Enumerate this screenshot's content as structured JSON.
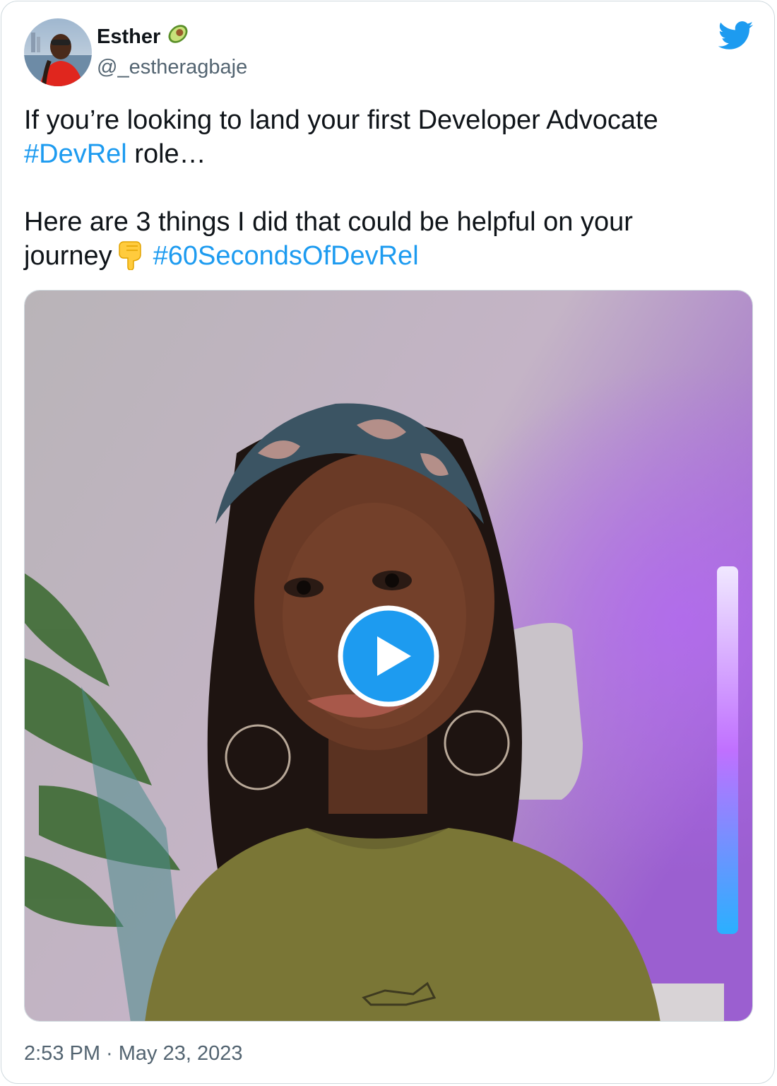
{
  "author": {
    "display_name": "Esther",
    "name_emoji_icon": "avocado-icon",
    "handle": "@_estheragbaje",
    "avatar_icon": "avatar-photo"
  },
  "tweet": {
    "line1": "If you’re looking to land your first Developer Advocate",
    "hashtag1": "#DevRel",
    "line2_rest": " role…",
    "line3": "Here are 3 things I did that could be helpful on your",
    "line4_start": "journey",
    "emoji_icon": "pointing-down-emoji",
    "hashtag2": "#60SecondsOfDevRel"
  },
  "media": {
    "type": "video",
    "play_icon": "play-icon"
  },
  "meta": {
    "timestamp": "2:53 PM · May 23, 2023"
  },
  "colors": {
    "link": "#1d9bf0",
    "text": "#0f1419",
    "muted": "#536471",
    "border": "#cfd9de",
    "twitter_blue": "#1d9bf0"
  }
}
